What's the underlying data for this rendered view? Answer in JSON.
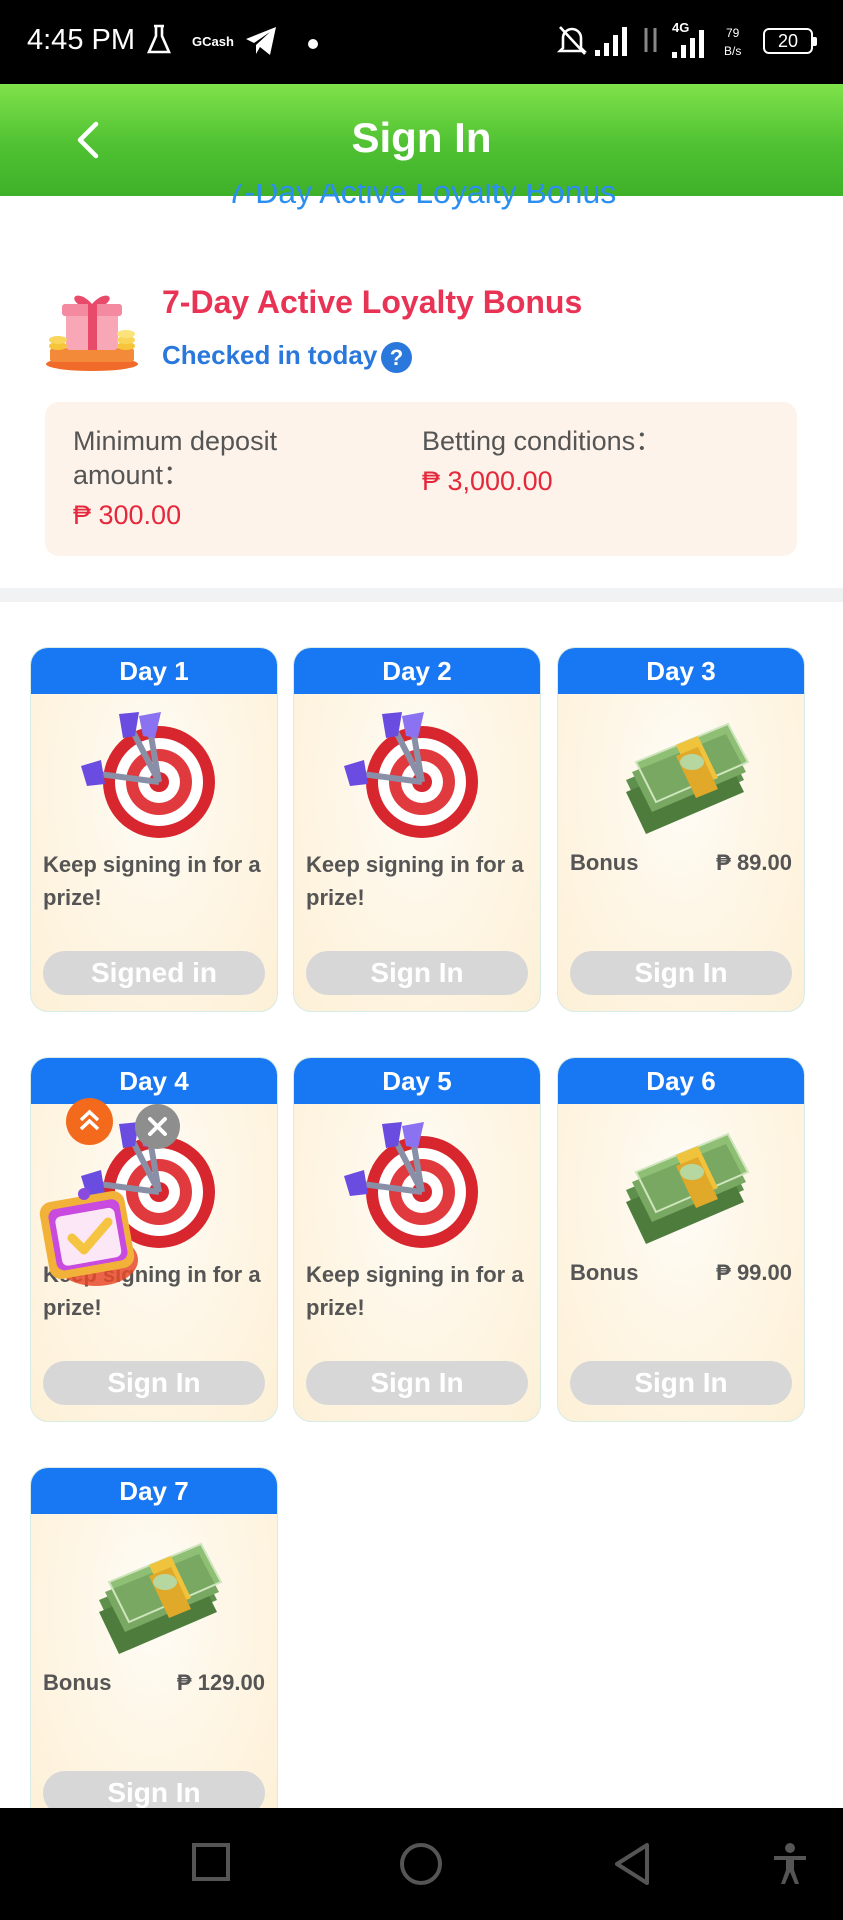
{
  "status_bar": {
    "time": "4:45 PM",
    "gcash": "GCash",
    "network": "4G",
    "speed_value": "79",
    "speed_unit": "B/s",
    "battery": "20"
  },
  "header": {
    "title": "Sign In"
  },
  "peek_title": "7-Day Active Loyalty Bonus",
  "bonus": {
    "title": "7-Day Active Loyalty Bonus",
    "checked_in": "Checked in today",
    "help": "?",
    "min_deposit_label_1": "Minimum deposit",
    "min_deposit_label_2": "amount：",
    "min_deposit_value": "₱ 300.00",
    "betting_label": "Betting conditions：",
    "betting_value": "₱ 3,000.00"
  },
  "days": [
    {
      "label": "Day 1",
      "type": "target",
      "message": "Keep signing in for a prize!",
      "button": "Signed in"
    },
    {
      "label": "Day 2",
      "type": "target",
      "message": "Keep signing in for a prize!",
      "button": "Sign In"
    },
    {
      "label": "Day 3",
      "type": "cash",
      "bonus_label": "Bonus",
      "amount": "₱ 89.00",
      "button": "Sign In"
    },
    {
      "label": "Day 4",
      "type": "target",
      "message": "Keep signing in for a prize!",
      "button": "Sign In"
    },
    {
      "label": "Day 5",
      "type": "target",
      "message": "Keep signing in for a prize!",
      "button": "Sign In"
    },
    {
      "label": "Day 6",
      "type": "cash",
      "bonus_label": "Bonus",
      "amount": "₱ 99.00",
      "button": "Sign In"
    },
    {
      "label": "Day 7",
      "type": "cash",
      "bonus_label": "Bonus",
      "amount": "₱ 129.00",
      "button": "Sign In"
    }
  ],
  "icons": {
    "back": "chevron-left-icon",
    "help": "question-circle-icon",
    "target": "dart-target-icon",
    "cash": "money-stack-icon",
    "float_up": "double-chevron-up-icon",
    "float_close": "close-icon",
    "float_badge": "checkin-calendar-icon"
  },
  "colors": {
    "header_green": "#4fc132",
    "card_blue": "#1877f2",
    "title_red": "#e83355",
    "link_blue": "#2b78dd",
    "value_red": "#e5283c",
    "button_gray": "#d7d7d7"
  }
}
